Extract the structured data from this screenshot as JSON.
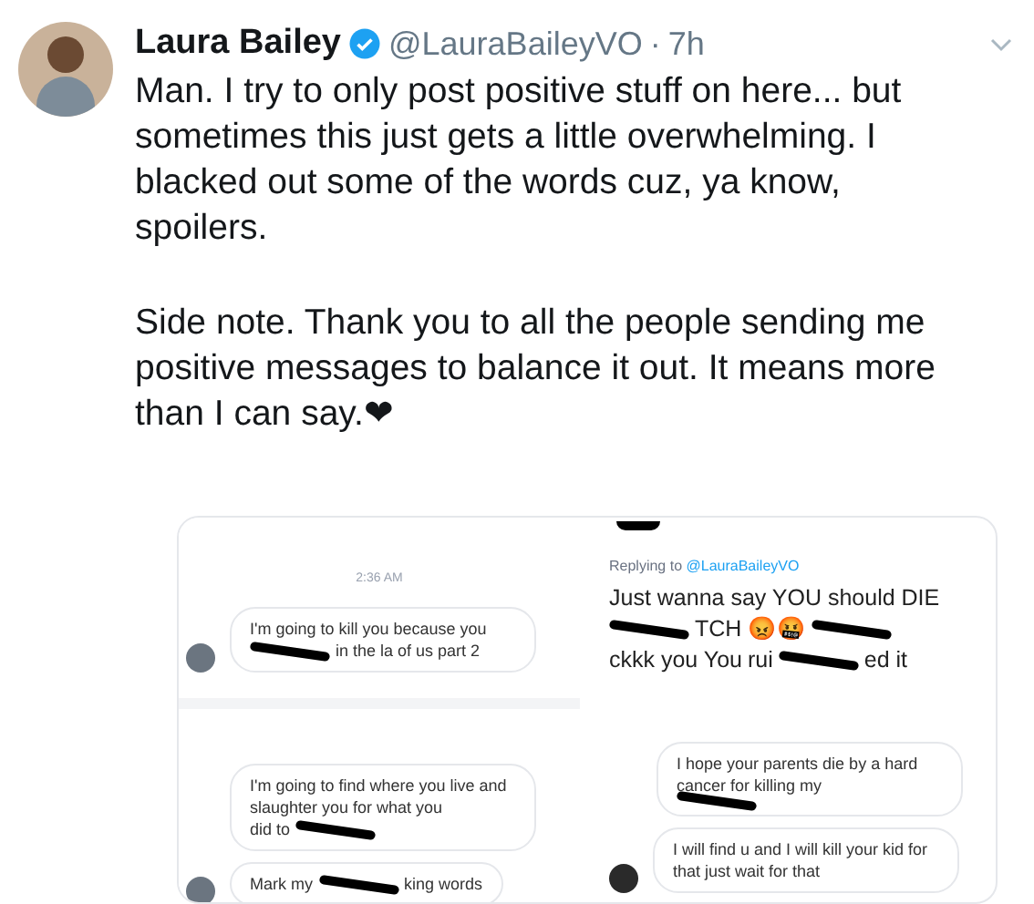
{
  "tweet": {
    "name": "Laura Bailey",
    "handle": "@LauraBaileyVO",
    "separator": "·",
    "time": "7h",
    "paragraphs": [
      "Man. I try to only post positive stuff on here... but sometimes this just gets a little overwhelming. I blacked out some of the words cuz, ya know, spoilers.",
      "Side note. Thank you to all the people sending me positive messages to balance it out. It means more than I can say.❤"
    ]
  },
  "attachment": {
    "left": {
      "time": "2:36 AM",
      "threads": [
        {
          "bubbles": [
            {
              "parts": [
                {
                  "kind": "text",
                  "text": "I'm going to kill you because you"
                },
                {
                  "kind": "redacted"
                },
                {
                  "kind": "text",
                  "text": "in the la of us part 2"
                }
              ]
            }
          ]
        },
        {
          "bubbles": [
            {
              "parts": [
                {
                  "kind": "text",
                  "text": "I'm going to find where you live and slaughter you for what you"
                },
                {
                  "kind": "text",
                  "text": "did to"
                },
                {
                  "kind": "redacted"
                }
              ]
            },
            {
              "parts": [
                {
                  "kind": "text",
                  "text": "Mark my"
                },
                {
                  "kind": "redacted"
                },
                {
                  "kind": "text",
                  "text": "king words"
                }
              ]
            }
          ]
        }
      ]
    },
    "right": {
      "replying_label": "Replying to",
      "replying_handle": "@LauraBaileyVO",
      "reply_parts": [
        {
          "kind": "text",
          "text": "Just wanna say YOU should DIE"
        },
        {
          "kind": "redacted"
        },
        {
          "kind": "text",
          "text": "TCH 😡🤬"
        },
        {
          "kind": "redacted"
        },
        {
          "kind": "text",
          "text": "ckkk you You"
        },
        {
          "kind": "text",
          "text": "rui"
        },
        {
          "kind": "redacted"
        },
        {
          "kind": "text",
          "text": "ed it"
        }
      ],
      "bubbles": [
        {
          "parts": [
            {
              "kind": "text",
              "text": "I hope your parents die by a hard cancer for killing my"
            },
            {
              "kind": "redacted"
            }
          ]
        },
        {
          "parts": [
            {
              "kind": "text",
              "text": "I will find u and I will kill your kid for that just wait for that"
            }
          ]
        }
      ]
    }
  }
}
